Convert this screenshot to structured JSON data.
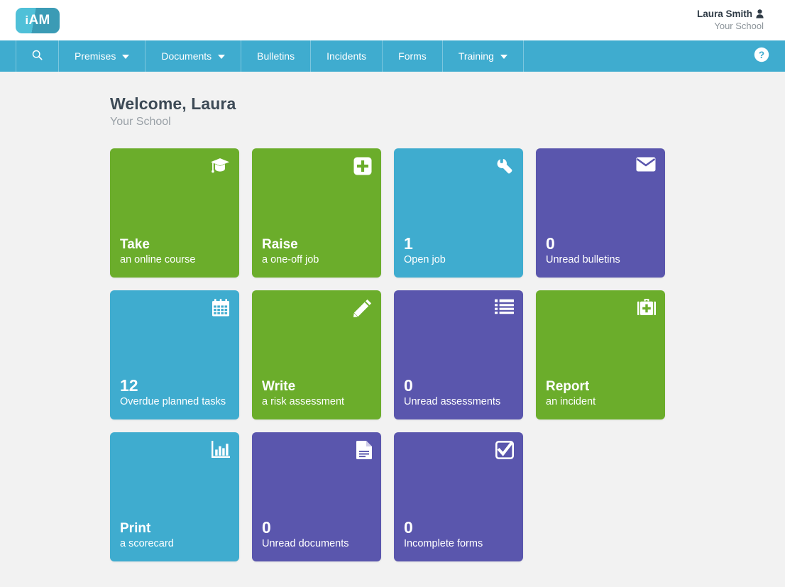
{
  "brand": {
    "logo_text_i": "i",
    "logo_text_am": "AM",
    "teal": "#3faccf",
    "green": "#6bad2b",
    "purple": "#5a56ad",
    "page_bg": "#f2f2f2"
  },
  "header": {
    "user_name": "Laura Smith",
    "user_org": "Your School"
  },
  "nav": {
    "search_label": "",
    "items": [
      {
        "label": "Premises",
        "has_caret": true
      },
      {
        "label": "Documents",
        "has_caret": true
      },
      {
        "label": "Bulletins",
        "has_caret": false
      },
      {
        "label": "Incidents",
        "has_caret": false
      },
      {
        "label": "Forms",
        "has_caret": false
      },
      {
        "label": "Training",
        "has_caret": true
      }
    ]
  },
  "main": {
    "welcome_title": "Welcome, Laura",
    "welcome_sub": "Your School",
    "tiles": [
      {
        "icon": "graduation-cap-icon",
        "color": "green",
        "count": "",
        "title": "Take",
        "sub": "an online course"
      },
      {
        "icon": "plus-square-icon",
        "color": "green",
        "count": "",
        "title": "Raise",
        "sub": "a one-off job"
      },
      {
        "icon": "wrench-icon",
        "color": "teal",
        "count": "1",
        "title": "",
        "sub": "Open job"
      },
      {
        "icon": "envelope-icon",
        "color": "purple",
        "count": "0",
        "title": "",
        "sub": "Unread bulletins"
      },
      {
        "icon": "calendar-icon",
        "color": "teal",
        "count": "12",
        "title": "",
        "sub": "Overdue planned tasks"
      },
      {
        "icon": "pencil-icon",
        "color": "green",
        "count": "",
        "title": "Write",
        "sub": "a risk assessment"
      },
      {
        "icon": "list-icon",
        "color": "purple",
        "count": "0",
        "title": "",
        "sub": "Unread assessments"
      },
      {
        "icon": "first-aid-kit-icon",
        "color": "green",
        "count": "",
        "title": "Report",
        "sub": "an incident"
      },
      {
        "icon": "bar-chart-icon",
        "color": "teal",
        "count": "",
        "title": "Print",
        "sub": "a scorecard"
      },
      {
        "icon": "document-icon",
        "color": "purple",
        "count": "0",
        "title": "",
        "sub": "Unread documents"
      },
      {
        "icon": "checkbox-checked-icon",
        "color": "purple",
        "count": "0",
        "title": "",
        "sub": "Incomplete forms"
      }
    ]
  }
}
